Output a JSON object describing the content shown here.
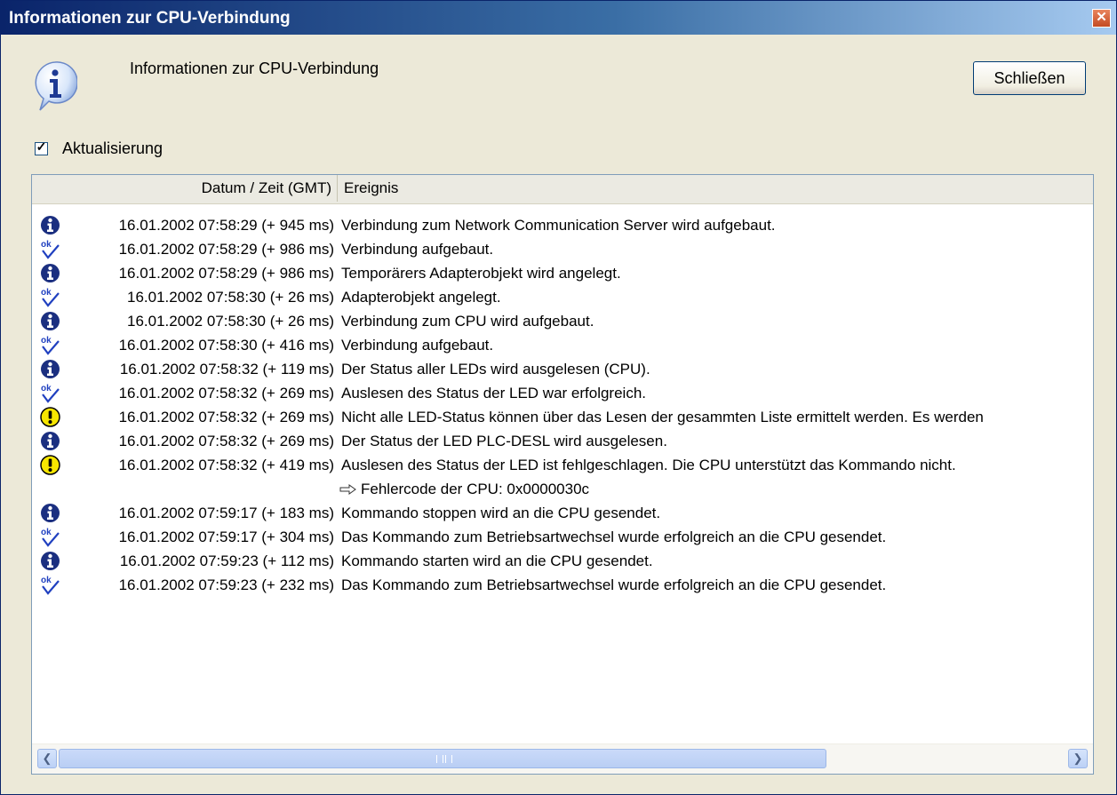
{
  "window": {
    "title": "Informationen zur CPU-Verbindung",
    "close_glyph": "✕"
  },
  "header": {
    "icon": "info-icon",
    "label": "Informationen zur CPU-Verbindung",
    "close_button": "Schließen"
  },
  "refresh": {
    "label": "Aktualisierung",
    "checked": true,
    "mark": "✓"
  },
  "table": {
    "columns": [
      "Datum / Zeit (GMT)",
      "Ereignis"
    ],
    "rows": [
      {
        "type": "info",
        "time": "16.01.2002 07:58:29 (+ 945 ms)",
        "event": "Verbindung zum Network Communication Server wird aufgebaut."
      },
      {
        "type": "ok",
        "time": "16.01.2002 07:58:29 (+ 986 ms)",
        "event": "Verbindung aufgebaut."
      },
      {
        "type": "info",
        "time": "16.01.2002 07:58:29 (+ 986 ms)",
        "event": "Temporärers Adapterobjekt wird angelegt."
      },
      {
        "type": "ok",
        "time": "16.01.2002 07:58:30 (+ 26 ms)",
        "event": "Adapterobjekt angelegt."
      },
      {
        "type": "info",
        "time": "16.01.2002 07:58:30 (+ 26 ms)",
        "event": "Verbindung zum CPU wird aufgebaut."
      },
      {
        "type": "ok",
        "time": "16.01.2002 07:58:30 (+ 416 ms)",
        "event": "Verbindung aufgebaut."
      },
      {
        "type": "info",
        "time": "16.01.2002 07:58:32 (+ 119 ms)",
        "event": "Der Status aller LEDs  wird ausgelesen (CPU)."
      },
      {
        "type": "ok",
        "time": "16.01.2002 07:58:32 (+ 269 ms)",
        "event": "Auslesen des Status der LED war erfolgreich."
      },
      {
        "type": "warning",
        "time": "16.01.2002 07:58:32 (+ 269 ms)",
        "event": "Nicht alle LED-Status können über das Lesen der gesammten Liste ermittelt werden. Es werden"
      },
      {
        "type": "info",
        "time": "16.01.2002 07:58:32 (+ 269 ms)",
        "event": "Der Status der LED PLC-DESL wird ausgelesen."
      },
      {
        "type": "warning",
        "time": "16.01.2002 07:58:32 (+ 419 ms)",
        "event": "Auslesen des Status der LED ist fehlgeschlagen. Die CPU unterstützt das Kommando nicht."
      },
      {
        "type": "detail",
        "time": "",
        "event": "Fehlercode der CPU: 0x0000030c"
      },
      {
        "type": "info",
        "time": "16.01.2002 07:59:17 (+ 183 ms)",
        "event": "Kommando stoppen wird an die CPU gesendet."
      },
      {
        "type": "ok",
        "time": "16.01.2002 07:59:17 (+ 304 ms)",
        "event": "Das Kommando zum Betriebsartwechsel wurde erfolgreich an die CPU gesendet."
      },
      {
        "type": "info",
        "time": "16.01.2002 07:59:23 (+ 112 ms)",
        "event": "Kommando starten wird an die CPU gesendet."
      },
      {
        "type": "ok",
        "time": "16.01.2002 07:59:23 (+ 232 ms)",
        "event": "Das Kommando zum Betriebsartwechsel wurde erfolgreich an die CPU gesendet."
      }
    ]
  },
  "scrollbar": {
    "left_glyph": "❮",
    "right_glyph": "❯"
  },
  "colors": {
    "title_bar_start": "#0A246A",
    "info_icon": "#1B2F80",
    "ok_icon": "#2040C0",
    "warning_icon": "#F7E600"
  }
}
